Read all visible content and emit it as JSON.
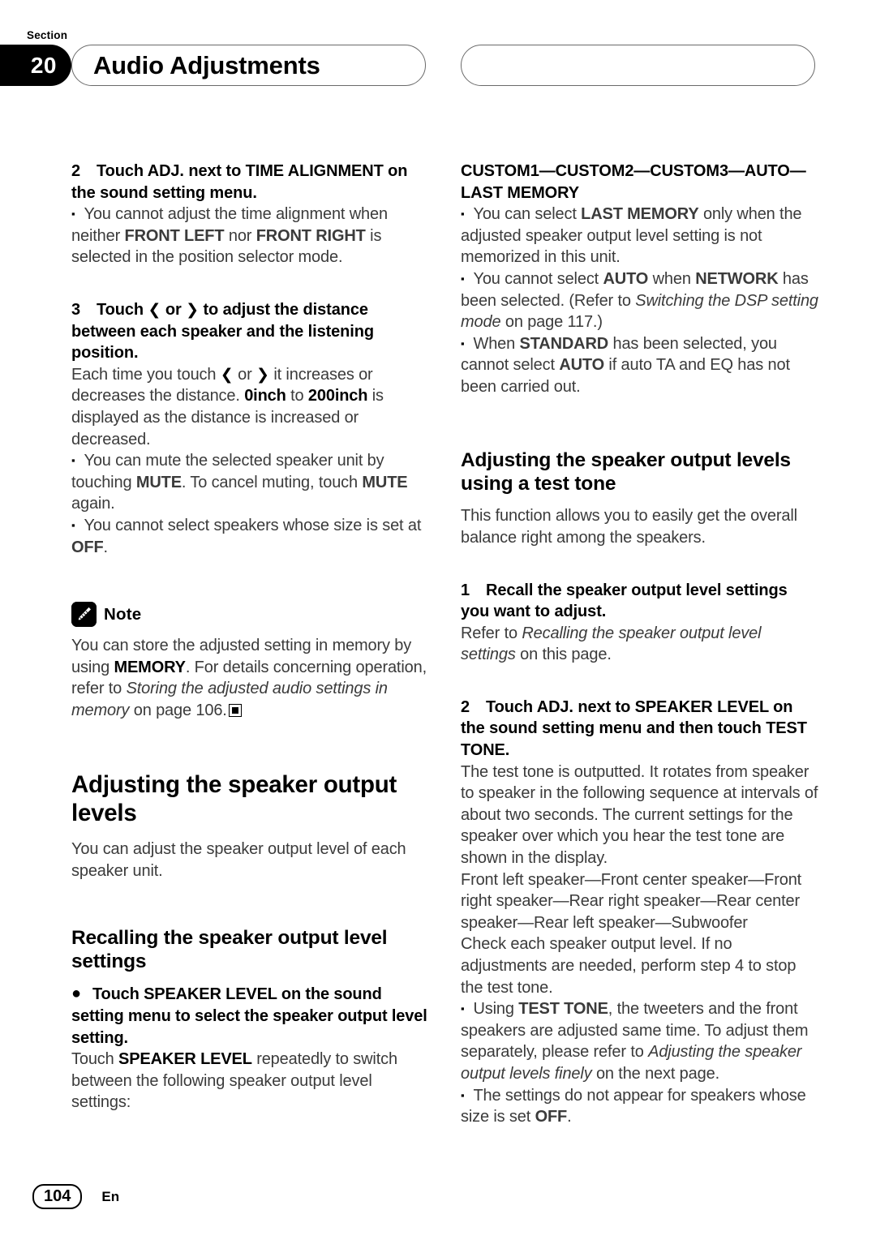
{
  "header": {
    "section_word": "Section",
    "section_number": "20",
    "title": "Audio Adjustments"
  },
  "footer": {
    "page_number": "104",
    "language": "En"
  },
  "left_column": {
    "step2": {
      "number": "2",
      "text": "Touch ADJ. next to TIME ALIGNMENT on the sound setting menu."
    },
    "step2_note": {
      "bullet": "▪",
      "text_a": "You cannot adjust the time alignment when neither ",
      "bold_a": "FRONT LEFT",
      "text_b": " nor ",
      "bold_b": "FRONT RIGHT",
      "text_c": " is selected in the position selector mode."
    },
    "step3": {
      "number": "3",
      "text_a": "Touch ",
      "chev_left": "❮",
      "text_b": " or ",
      "chev_right": "❯",
      "text_c": " to adjust the distance between each speaker and the listening position."
    },
    "step3_body": {
      "text_a": "Each time you touch ",
      "chev_left": "❮",
      "text_b": " or ",
      "chev_right": "❯",
      "text_c": " it increases or decreases the distance. ",
      "bold_a": "0inch",
      "text_d": " to ",
      "bold_b": "200inch",
      "text_e": " is displayed as the distance is increased or decreased."
    },
    "step3_note1": {
      "bullet": "▪",
      "text_a": "You can mute the selected speaker unit by touching ",
      "bold_a": "MUTE",
      "text_b": ". To cancel muting, touch ",
      "bold_b": "MUTE",
      "text_c": " again."
    },
    "step3_note2": {
      "bullet": "▪",
      "text_a": "You cannot select speakers whose size is set at ",
      "bold_a": "OFF",
      "text_b": "."
    },
    "note": {
      "icon": "pencil-icon",
      "label": "Note",
      "text_a": "You can store the adjusted setting in memory by using ",
      "bold_a": "MEMORY",
      "text_b": ". For details concerning operation, refer to ",
      "italic_a": "Storing the adjusted audio settings in memory",
      "text_c": " on page 106."
    },
    "heading_adjusting": "Adjusting the speaker output levels",
    "heading_adjusting_body": "You can adjust the speaker output level of each speaker unit.",
    "heading_recalling": "Recalling the speaker output level settings",
    "recalling_item": {
      "bullet": "●",
      "text": "Touch SPEAKER LEVEL on the sound setting menu to select the speaker output level setting."
    },
    "recalling_body": {
      "text_a": "Touch ",
      "bold_a": "SPEAKER LEVEL",
      "text_b": " repeatedly to switch between the following speaker output level settings:"
    }
  },
  "right_column": {
    "settings_sequence": "CUSTOM1—CUSTOM2—CUSTOM3—AUTO—LAST MEMORY",
    "note1": {
      "bullet": "▪",
      "text_a": "You can select ",
      "bold_a": "LAST MEMORY",
      "text_b": " only when the adjusted speaker output level setting is not memorized in this unit."
    },
    "note2": {
      "bullet": "▪",
      "text_a": "You cannot select ",
      "bold_a": "AUTO",
      "text_b": " when ",
      "bold_b": "NETWORK",
      "text_c": " has been selected. (Refer to ",
      "italic_a": "Switching the DSP setting mode",
      "text_d": " on page 117.)"
    },
    "note3": {
      "bullet": "▪",
      "text_a": "When ",
      "bold_a": "STANDARD",
      "text_b": " has been selected, you cannot select ",
      "bold_b": "AUTO",
      "text_c": " if auto TA and EQ has not been carried out."
    },
    "heading_test_tone": "Adjusting the speaker output levels using a test tone",
    "test_tone_intro": "This function allows you to easily get the overall balance right among the speakers.",
    "step1": {
      "number": "1",
      "text": "Recall the speaker output level settings you want to adjust."
    },
    "step1_body": {
      "text_a": "Refer to ",
      "italic_a": "Recalling the speaker output level settings",
      "text_b": " on this page."
    },
    "step2": {
      "number": "2",
      "text": "Touch ADJ. next to SPEAKER LEVEL on the sound setting menu and then touch TEST TONE."
    },
    "step2_body": "The test tone is outputted. It rotates from speaker to speaker in the following sequence at intervals of about two seconds. The current settings for the speaker over which you hear the test tone are shown in the display.",
    "speaker_sequence": "Front left speaker—Front center speaker—Front right speaker—Rear right speaker—Rear center speaker—Rear left speaker—Subwoofer",
    "step2_body2": "Check each speaker output level. If no adjustments are needed, perform step 4 to stop the test tone.",
    "note4": {
      "bullet": "▪",
      "text_a": "Using ",
      "bold_a": "TEST TONE",
      "text_b": ", the tweeters and the front speakers are adjusted same time. To adjust them separately, please refer to ",
      "italic_a": "Adjusting the speaker output levels finely",
      "text_c": " on the next page."
    },
    "note5": {
      "bullet": "▪",
      "text_a": "The settings do not appear for speakers whose size is set ",
      "bold_a": "OFF",
      "text_b": "."
    }
  }
}
